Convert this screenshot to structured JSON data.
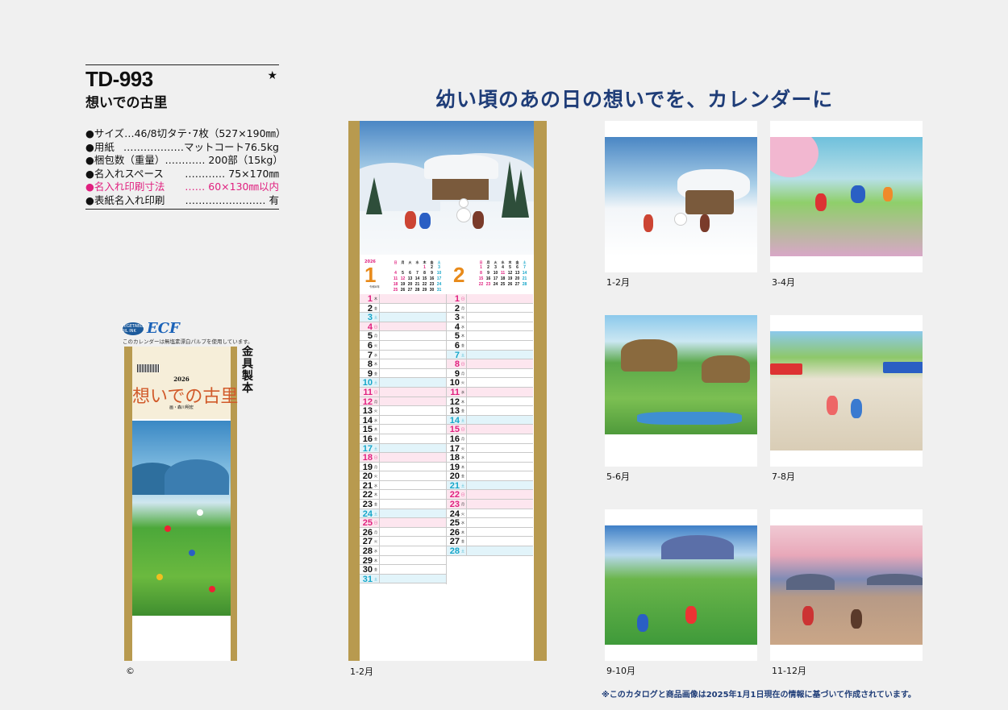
{
  "product": {
    "code": "TD-993",
    "star": "★",
    "name": "想いでの古里",
    "specs": [
      {
        "label": "サイズ",
        "value": "…46/8切タテ･7枚（527×190㎜）",
        "pink": false
      },
      {
        "label": "用紙",
        "value": "………………マットコート76.5kg",
        "pink": false
      },
      {
        "label": "梱包数（重量）",
        "value": "………… 200部（15kg）",
        "pink": false
      },
      {
        "label": "名入れスペース",
        "value": "………… 75×170㎜",
        "pink": false
      },
      {
        "label": "名入れ印刷寸法",
        "value": "…… 60×130㎜以内",
        "pink": true
      },
      {
        "label": "表紙名入れ印刷",
        "value": "…………………… 有",
        "pink": false
      }
    ]
  },
  "headline": "幼い頃のあの日の想いでを、カレンダーに",
  "ecf": {
    "badge": "VEGETABLE OIL INK",
    "logo": "ECF",
    "note": "このカレンダーは無塩素漂白パルプを使用しています。"
  },
  "cover": {
    "year": "2026",
    "title": "想いでの古里",
    "author": "画・森川明宏"
  },
  "binding": "金具製本",
  "copyright": "©",
  "main_label": "1-2月",
  "calendar": {
    "year": "2026",
    "era_note": "令和8年",
    "months": [
      {
        "num": "1",
        "weekdays": [
          "日",
          "月",
          "火",
          "水",
          "木",
          "金",
          "土"
        ],
        "weeks": [
          [
            "",
            "",
            "",
            "",
            "1",
            "2",
            "3"
          ],
          [
            "4",
            "5",
            "6",
            "7",
            "8",
            "9",
            "10"
          ],
          [
            "11",
            "12",
            "13",
            "14",
            "15",
            "16",
            "17"
          ],
          [
            "18",
            "19",
            "20",
            "21",
            "22",
            "23",
            "24"
          ],
          [
            "25",
            "26",
            "27",
            "28",
            "29",
            "30",
            "31"
          ]
        ],
        "days": [
          {
            "d": "1",
            "w": "木",
            "t": "hol"
          },
          {
            "d": "2",
            "w": "金",
            "t": ""
          },
          {
            "d": "3",
            "w": "土",
            "t": "sat"
          },
          {
            "d": "4",
            "w": "日",
            "t": "sun"
          },
          {
            "d": "5",
            "w": "月",
            "t": ""
          },
          {
            "d": "6",
            "w": "火",
            "t": ""
          },
          {
            "d": "7",
            "w": "水",
            "t": ""
          },
          {
            "d": "8",
            "w": "木",
            "t": ""
          },
          {
            "d": "9",
            "w": "金",
            "t": ""
          },
          {
            "d": "10",
            "w": "土",
            "t": "sat"
          },
          {
            "d": "11",
            "w": "日",
            "t": "sun"
          },
          {
            "d": "12",
            "w": "月",
            "t": "hol"
          },
          {
            "d": "13",
            "w": "火",
            "t": ""
          },
          {
            "d": "14",
            "w": "水",
            "t": ""
          },
          {
            "d": "15",
            "w": "木",
            "t": ""
          },
          {
            "d": "16",
            "w": "金",
            "t": ""
          },
          {
            "d": "17",
            "w": "土",
            "t": "sat"
          },
          {
            "d": "18",
            "w": "日",
            "t": "sun"
          },
          {
            "d": "19",
            "w": "月",
            "t": ""
          },
          {
            "d": "20",
            "w": "火",
            "t": ""
          },
          {
            "d": "21",
            "w": "水",
            "t": ""
          },
          {
            "d": "22",
            "w": "木",
            "t": ""
          },
          {
            "d": "23",
            "w": "金",
            "t": ""
          },
          {
            "d": "24",
            "w": "土",
            "t": "sat"
          },
          {
            "d": "25",
            "w": "日",
            "t": "sun"
          },
          {
            "d": "26",
            "w": "月",
            "t": ""
          },
          {
            "d": "27",
            "w": "火",
            "t": ""
          },
          {
            "d": "28",
            "w": "水",
            "t": ""
          },
          {
            "d": "29",
            "w": "木",
            "t": ""
          },
          {
            "d": "30",
            "w": "金",
            "t": ""
          },
          {
            "d": "31",
            "w": "土",
            "t": "sat"
          }
        ]
      },
      {
        "num": "2",
        "weekdays": [
          "日",
          "月",
          "火",
          "水",
          "木",
          "金",
          "土"
        ],
        "weeks": [
          [
            "1",
            "2",
            "3",
            "4",
            "5",
            "6",
            "7"
          ],
          [
            "8",
            "9",
            "10",
            "11",
            "12",
            "13",
            "14"
          ],
          [
            "15",
            "16",
            "17",
            "18",
            "19",
            "20",
            "21"
          ],
          [
            "22",
            "23",
            "24",
            "25",
            "26",
            "27",
            "28"
          ]
        ],
        "days": [
          {
            "d": "1",
            "w": "日",
            "t": "sun"
          },
          {
            "d": "2",
            "w": "月",
            "t": ""
          },
          {
            "d": "3",
            "w": "火",
            "t": ""
          },
          {
            "d": "4",
            "w": "水",
            "t": ""
          },
          {
            "d": "5",
            "w": "木",
            "t": ""
          },
          {
            "d": "6",
            "w": "金",
            "t": ""
          },
          {
            "d": "7",
            "w": "土",
            "t": "sat"
          },
          {
            "d": "8",
            "w": "日",
            "t": "sun"
          },
          {
            "d": "9",
            "w": "月",
            "t": ""
          },
          {
            "d": "10",
            "w": "火",
            "t": ""
          },
          {
            "d": "11",
            "w": "水",
            "t": "hol"
          },
          {
            "d": "12",
            "w": "木",
            "t": ""
          },
          {
            "d": "13",
            "w": "金",
            "t": ""
          },
          {
            "d": "14",
            "w": "土",
            "t": "sat"
          },
          {
            "d": "15",
            "w": "日",
            "t": "sun"
          },
          {
            "d": "16",
            "w": "月",
            "t": ""
          },
          {
            "d": "17",
            "w": "火",
            "t": ""
          },
          {
            "d": "18",
            "w": "水",
            "t": ""
          },
          {
            "d": "19",
            "w": "木",
            "t": ""
          },
          {
            "d": "20",
            "w": "金",
            "t": ""
          },
          {
            "d": "21",
            "w": "土",
            "t": "sat"
          },
          {
            "d": "22",
            "w": "日",
            "t": "sun"
          },
          {
            "d": "23",
            "w": "月",
            "t": "hol"
          },
          {
            "d": "24",
            "w": "火",
            "t": ""
          },
          {
            "d": "25",
            "w": "水",
            "t": ""
          },
          {
            "d": "26",
            "w": "木",
            "t": ""
          },
          {
            "d": "27",
            "w": "金",
            "t": ""
          },
          {
            "d": "28",
            "w": "土",
            "t": "sat"
          }
        ]
      }
    ]
  },
  "thumbnails": [
    {
      "label": "1-2月",
      "scene": "winter-snowman"
    },
    {
      "label": "3-4月",
      "scene": "spring-cherry"
    },
    {
      "label": "5-6月",
      "scene": "summer-farm"
    },
    {
      "label": "7-8月",
      "scene": "festival-market"
    },
    {
      "label": "9-10月",
      "scene": "autumn-meadow"
    },
    {
      "label": "11-12月",
      "scene": "sunset-sea"
    }
  ],
  "footnote": "※このカタログと商品画像は2025年1月1日現在の情報に基づいて作成されています。"
}
